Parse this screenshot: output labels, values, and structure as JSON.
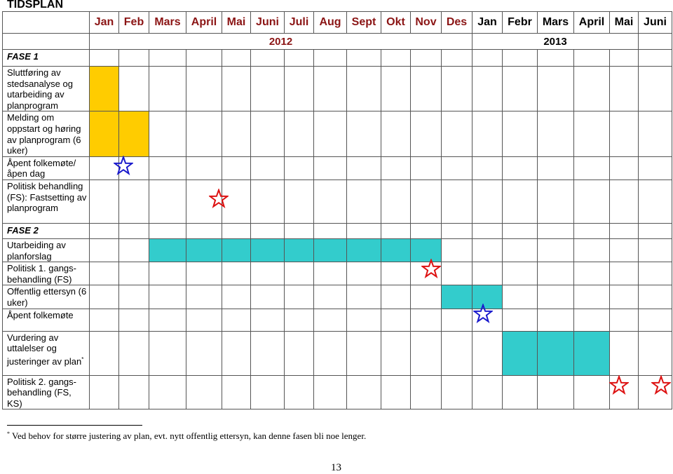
{
  "title": "TIDSPLAN",
  "months": [
    {
      "label": "Jan",
      "year": "2012"
    },
    {
      "label": "Feb",
      "year": "2012"
    },
    {
      "label": "Mars",
      "year": "2012"
    },
    {
      "label": "April",
      "year": "2012"
    },
    {
      "label": "Mai",
      "year": "2012"
    },
    {
      "label": "Juni",
      "year": "2012"
    },
    {
      "label": "Juli",
      "year": "2012"
    },
    {
      "label": "Aug",
      "year": "2012"
    },
    {
      "label": "Sept",
      "year": "2012"
    },
    {
      "label": "Okt",
      "year": "2012"
    },
    {
      "label": "Nov",
      "year": "2012"
    },
    {
      "label": "Des",
      "year": "2012"
    },
    {
      "label": "Jan",
      "year": "2013"
    },
    {
      "label": "Febr",
      "year": "2013"
    },
    {
      "label": "Mars",
      "year": "2013"
    },
    {
      "label": "April",
      "year": "2013"
    },
    {
      "label": "Mai",
      "year": "2013"
    },
    {
      "label": "Juni",
      "year": "2013"
    }
  ],
  "years": [
    "2012",
    "2013"
  ],
  "colors": {
    "month_2012": "#8b1515",
    "fase1_bar": "#ffcc00",
    "fase2_bar": "#33cccc",
    "star_blue": "#1a1acc",
    "star_red": "#dd1111"
  },
  "rows": [
    {
      "type": "phase",
      "label": "FASE 1"
    },
    {
      "type": "task",
      "label": "Sluttføring av stedsanalyse og utarbeiding av planprogram",
      "bar": [
        0
      ],
      "color": "yellow"
    },
    {
      "type": "task",
      "label": "Melding om oppstart og høring av planprogram (6 uker)",
      "bar": [
        0,
        1
      ],
      "color": "yellow"
    },
    {
      "type": "task",
      "label": "Åpent folkemøte/ åpen dag",
      "stars": [
        {
          "month": 1,
          "color": "blue"
        }
      ]
    },
    {
      "type": "task",
      "label": "Politisk behandling (FS): Fastsetting av planprogram",
      "stars": [
        {
          "month": 3,
          "color": "red"
        }
      ]
    },
    {
      "type": "phase",
      "label": "FASE 2"
    },
    {
      "type": "task",
      "label": "Utarbeiding av planforslag",
      "bar": [
        2,
        3,
        4,
        5,
        6,
        7,
        8,
        9,
        10
      ],
      "color": "teal"
    },
    {
      "type": "task",
      "label": "Politisk 1. gangs-behandling (FS)",
      "stars": [
        {
          "month": 10,
          "color": "red"
        }
      ]
    },
    {
      "type": "task",
      "label": "Offentlig ettersyn (6 uker)",
      "bar": [
        11,
        12
      ],
      "color": "teal"
    },
    {
      "type": "task",
      "label": "Åpent folkemøte",
      "stars": [
        {
          "month": 12,
          "color": "blue"
        }
      ]
    },
    {
      "type": "task",
      "label": "Vurdering av uttalelser og justeringer av plan",
      "footnote_mark": "*",
      "bar": [
        13,
        14,
        15
      ],
      "color": "teal"
    },
    {
      "type": "task",
      "label": "Politisk 2. gangs-behandling (FS, KS)",
      "stars": [
        {
          "month": 16,
          "color": "red"
        },
        {
          "month": 17,
          "color": "red"
        }
      ]
    }
  ],
  "footnote": {
    "mark": "*",
    "text": "Ved behov for større justering av plan, evt. nytt offentlig ettersyn, kan denne fasen bli noe lenger."
  },
  "page_number": "13"
}
